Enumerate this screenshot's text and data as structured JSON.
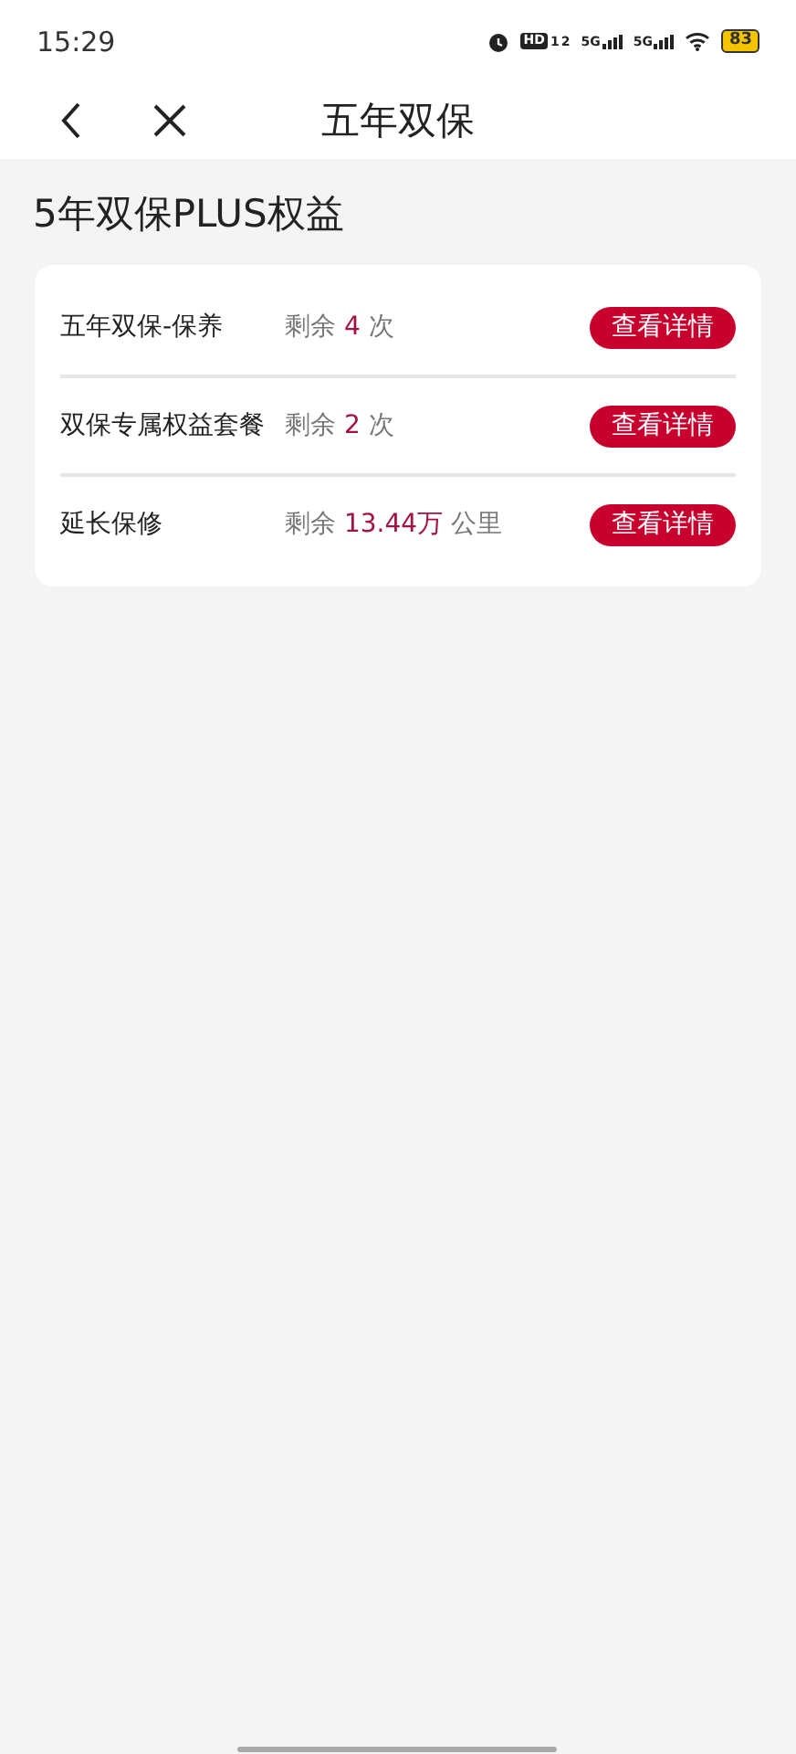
{
  "status_bar": {
    "time": "15:29",
    "hd": "HD",
    "hd_sub": "1",
    "hd_sub2": "2",
    "network": [
      "5G",
      "5G"
    ],
    "battery": "83"
  },
  "nav": {
    "title": "五年双保"
  },
  "section_title": "5年双保PLUS权益",
  "benefits": [
    {
      "name": "五年双保-保养",
      "prefix": "剩余",
      "value": "4",
      "unit": "次",
      "button": "查看详情"
    },
    {
      "name": "双保专属权益套餐",
      "prefix": "剩余",
      "value": "2",
      "unit": "次",
      "button": "查看详情"
    },
    {
      "name": "延长保修",
      "prefix": "剩余",
      "value": "13.44万",
      "unit": "公里",
      "button": "查看详情"
    }
  ]
}
